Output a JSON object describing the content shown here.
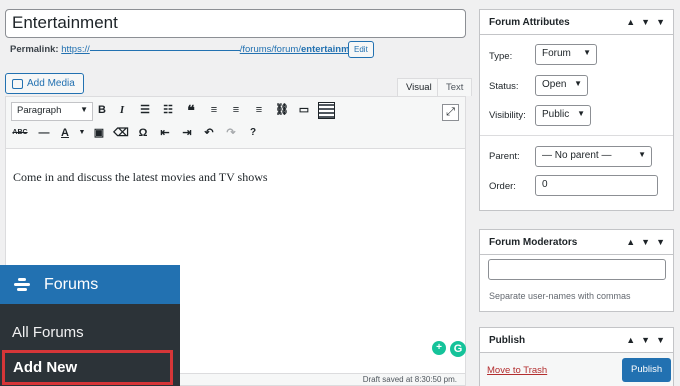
{
  "post": {
    "title": "Entertainment",
    "permalink_label": "Permalink:",
    "permalink_prefix": "https://",
    "permalink_mid": "/forums/forum/",
    "permalink_slug": "entertainment",
    "permalink_suffix": "/",
    "edit_label": "Edit"
  },
  "editor": {
    "add_media_label": "Add Media",
    "tab_visual": "Visual",
    "tab_text": "Text",
    "format_select": "Paragraph",
    "content": "Come in and discuss the latest movies and TV shows",
    "status": "Draft saved at 8:30:50 pm."
  },
  "admin_menu": {
    "section": "Forums",
    "items": [
      "All Forums",
      "Add New"
    ],
    "active_color": "#d63638"
  },
  "forum_attributes": {
    "title": "Forum Attributes",
    "type_label": "Type:",
    "type_value": "Forum",
    "status_label": "Status:",
    "status_value": "Open",
    "visibility_label": "Visibility:",
    "visibility_value": "Public",
    "parent_label": "Parent:",
    "parent_value": "— No parent —",
    "order_label": "Order:",
    "order_value": "0"
  },
  "forum_moderators": {
    "title": "Forum Moderators",
    "hint": "Separate user-names with commas"
  },
  "publish": {
    "title": "Publish",
    "trash_label": "Move to Trash",
    "publish_label": "Publish"
  },
  "colors": {
    "accent": "#2271b1",
    "menu_bg": "#2c3338"
  }
}
